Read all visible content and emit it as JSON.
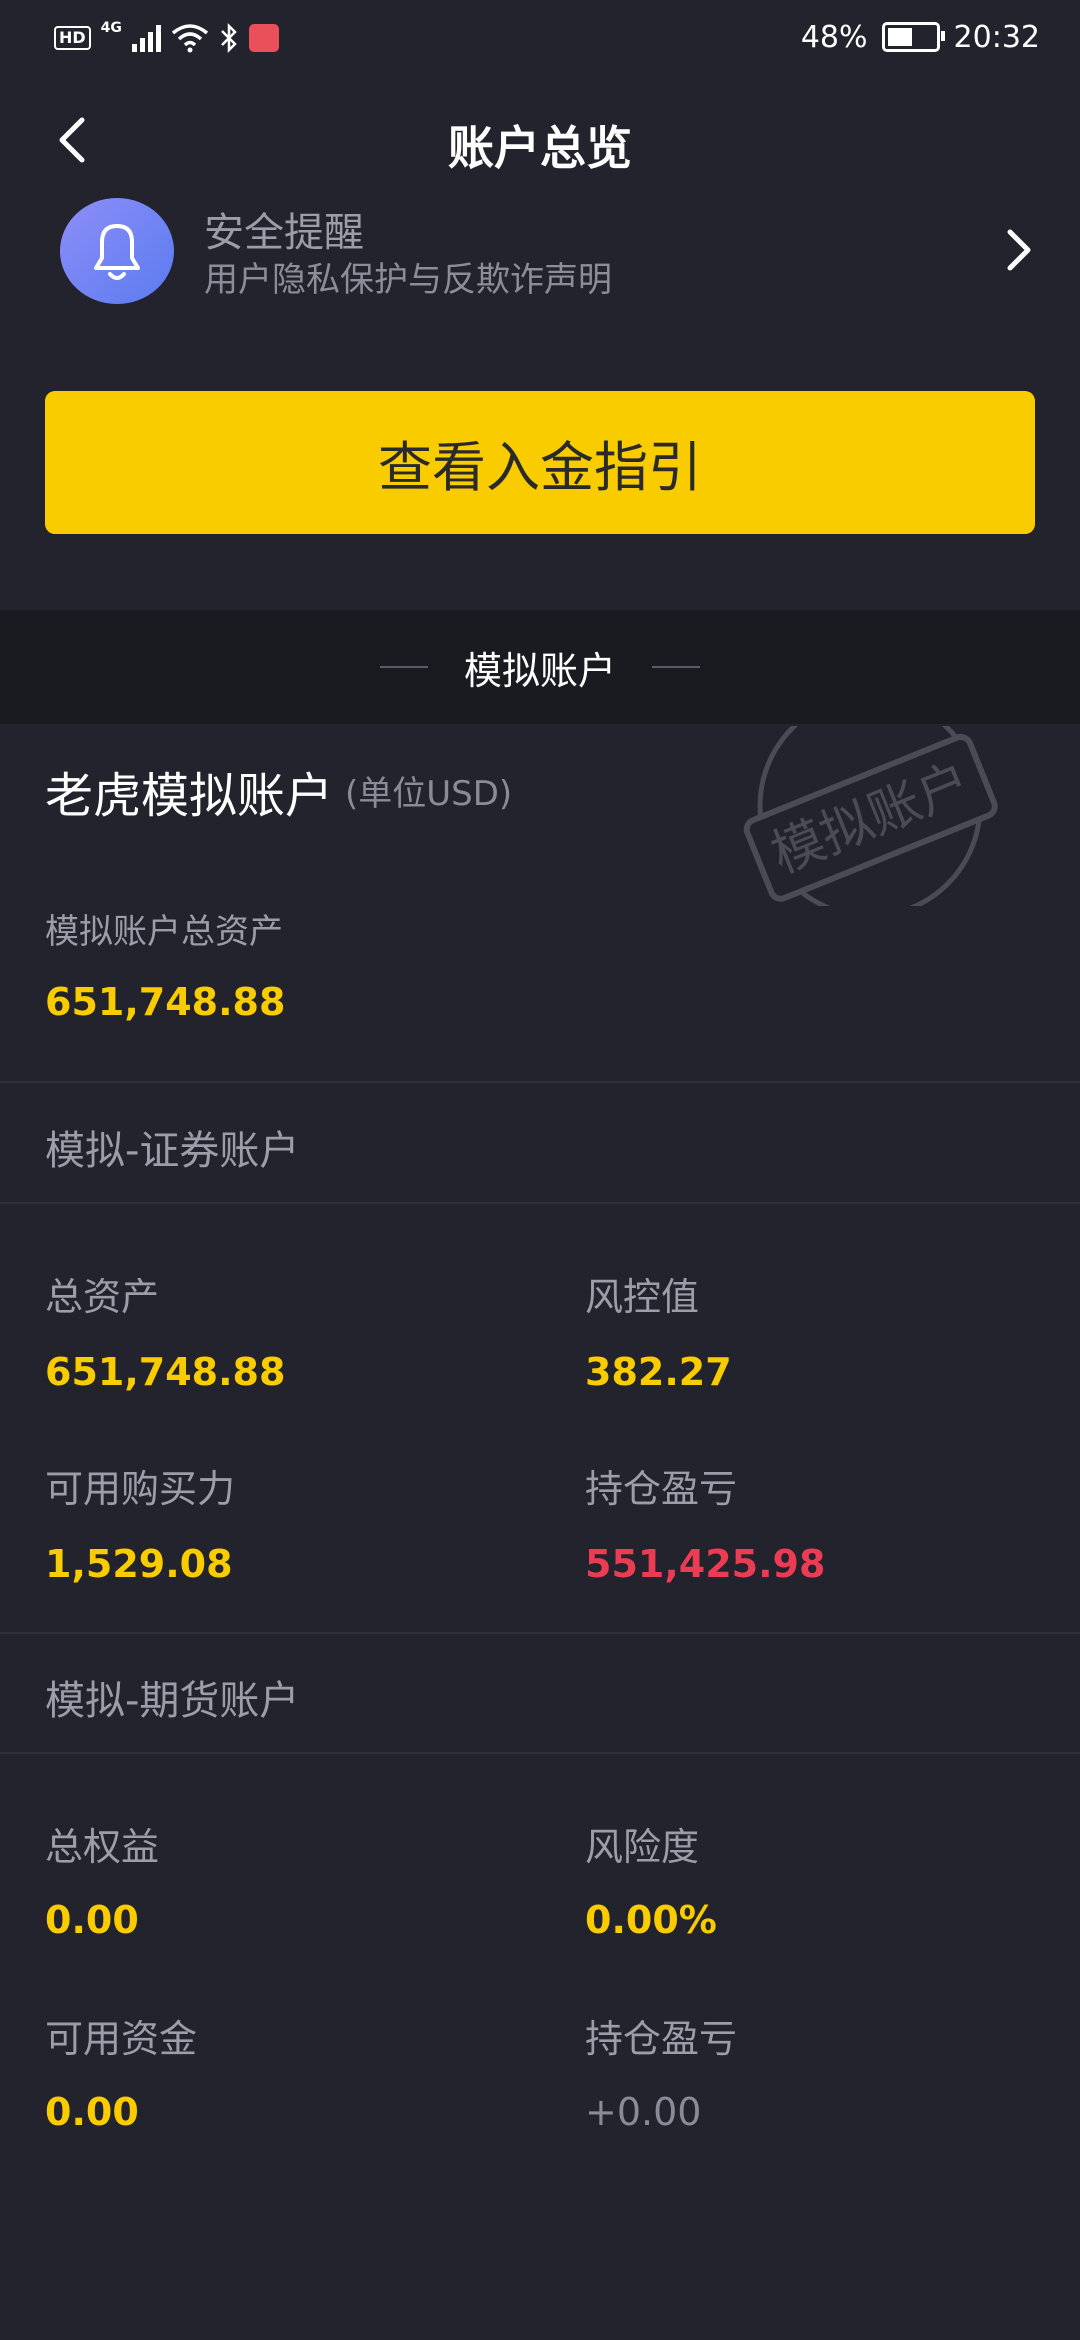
{
  "status_bar": {
    "battery": "48%",
    "battery_level": 0.48,
    "time": "20:32",
    "network": "4G",
    "hd": "HD"
  },
  "header": {
    "title": "账户总览"
  },
  "notice": {
    "title": "安全提醒",
    "subtitle": "用户隐私保护与反欺诈声明"
  },
  "guide_button": {
    "label": "查看入金指引"
  },
  "section": {
    "label": "模拟账户"
  },
  "account": {
    "title": "老虎模拟账户",
    "unit": "(单位USD)",
    "stamp_text": "模拟账户",
    "total_assets_label": "模拟账户总资产",
    "total_assets_value": "651,748.88"
  },
  "securities": {
    "header": "模拟-证券账户",
    "total_assets_label": "总资产",
    "total_assets_value": "651,748.88",
    "risk_label": "风控值",
    "risk_value": "382.27",
    "buying_power_label": "可用购买力",
    "buying_power_value": "1,529.08",
    "pnl_label": "持仓盈亏",
    "pnl_value": "551,425.98"
  },
  "futures": {
    "header": "模拟-期货账户",
    "equity_label": "总权益",
    "equity_value": "0.00",
    "risk_label": "风险度",
    "risk_value": "0.00%",
    "funds_label": "可用资金",
    "funds_value": "0.00",
    "pnl_label": "持仓盈亏",
    "pnl_value": "+0.00"
  },
  "colors": {
    "accent": "#f9cc00",
    "loss": "#ec3c54",
    "background": "#22232c"
  }
}
